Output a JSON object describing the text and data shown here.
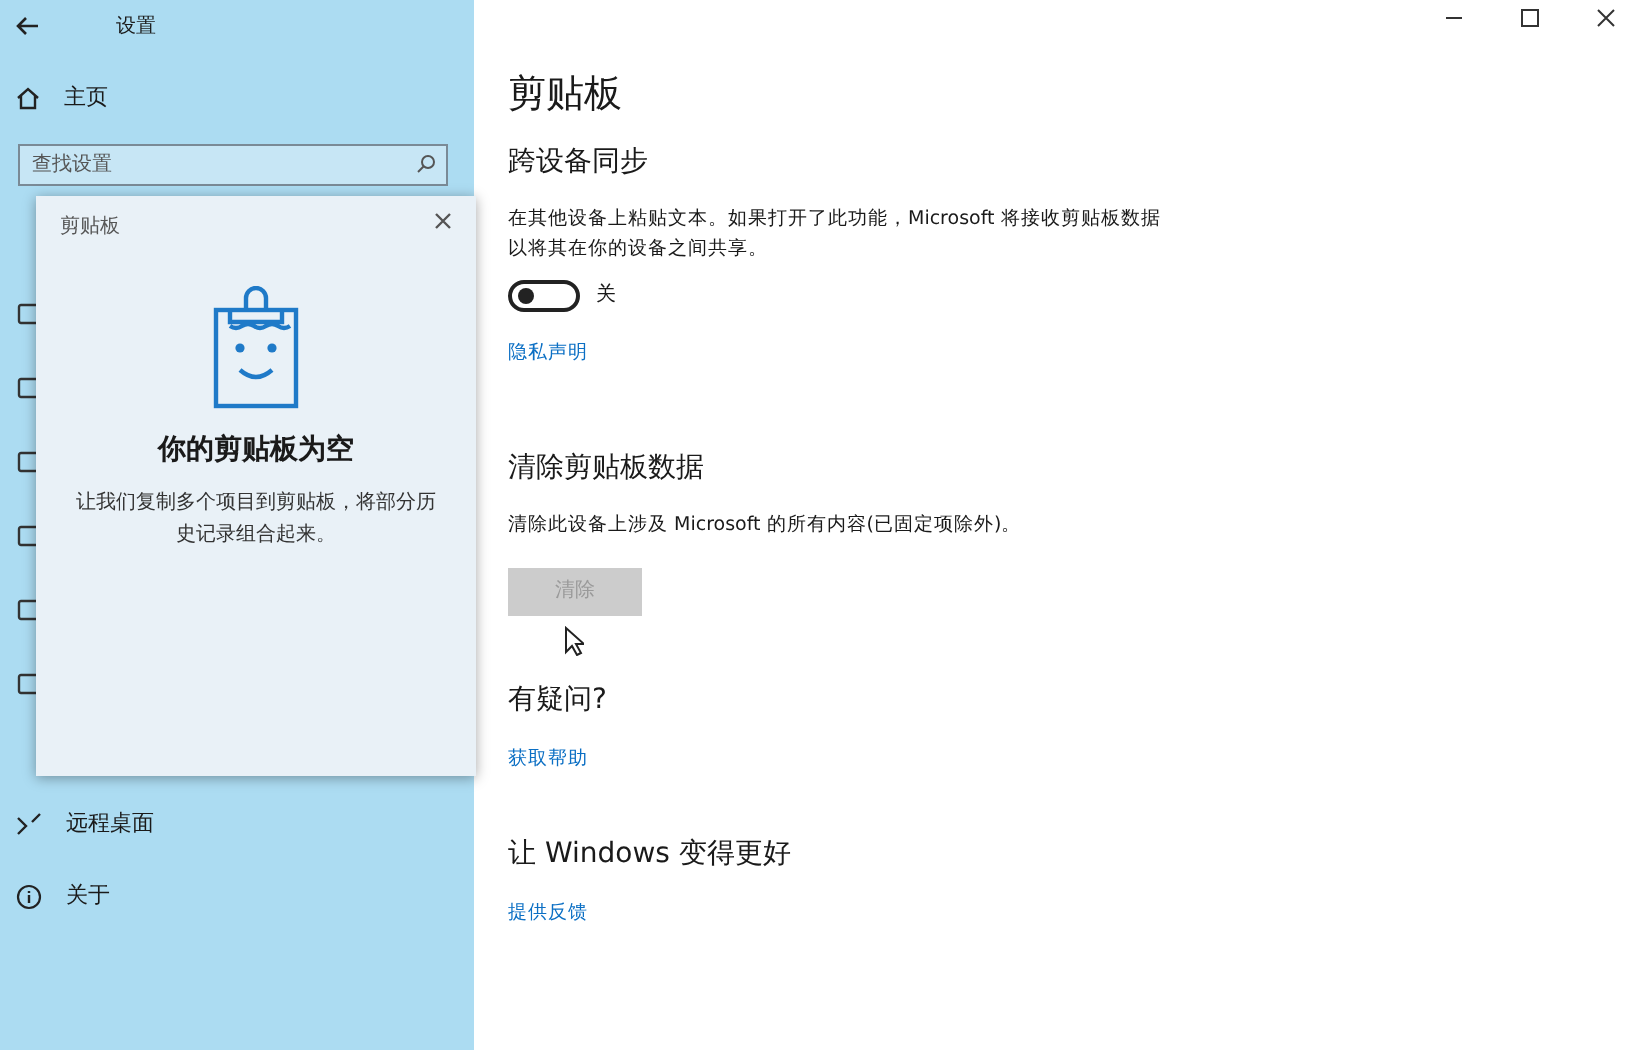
{
  "window": {
    "title": "设置"
  },
  "sidebar": {
    "home": "主页",
    "search": {
      "placeholder": "查找设置"
    },
    "items": [
      {
        "label": "远程桌面",
        "kind": "remote"
      },
      {
        "label": "关于",
        "kind": "info"
      }
    ]
  },
  "clipboard_popup": {
    "title": "剪贴板",
    "heading": "你的剪贴板为空",
    "message": "让我们复制多个项目到剪贴板，将部分历史记录组合起来。"
  },
  "page": {
    "title": "剪贴板",
    "sections": [
      {
        "kind": "sync",
        "heading": "跨设备同步",
        "text": "在其他设备上粘贴文本。如果打开了此功能，Microsoft 将接收剪贴板数据以将其在你的设备之间共享。",
        "toggle": {
          "on": false,
          "label": "关"
        },
        "link": "隐私声明"
      },
      {
        "kind": "clear",
        "heading": "清除剪贴板数据",
        "text": "清除此设备上涉及 Microsoft 的所有内容(已固定项除外)。",
        "button": {
          "label": "清除",
          "disabled": true
        }
      },
      {
        "kind": "help",
        "heading": "有疑问?",
        "link": "获取帮助"
      },
      {
        "kind": "feedback",
        "heading": "让 Windows 变得更好",
        "link": "提供反馈"
      }
    ]
  }
}
